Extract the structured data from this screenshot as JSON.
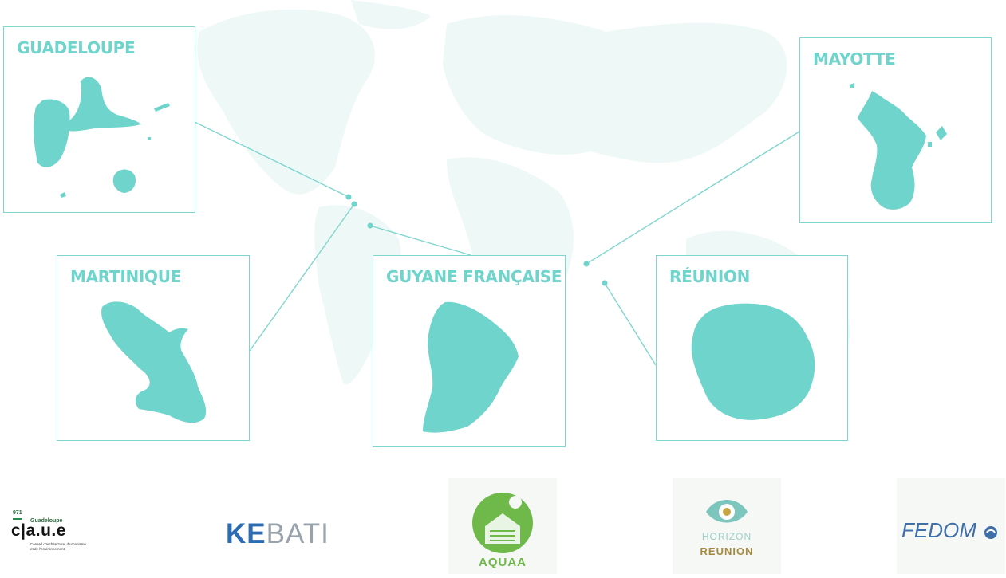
{
  "colors": {
    "accent": "#6fd4cc",
    "border": "#7fd6cf",
    "map_bg": "#eef9f7"
  },
  "regions": {
    "guadeloupe": {
      "name": "GUADELOUPE"
    },
    "mayotte": {
      "name": "MAYOTTE"
    },
    "martinique": {
      "name": "MARTINIQUE"
    },
    "guyane": {
      "name": "GUYANE FRANÇAISE"
    },
    "reunion": {
      "name": "RÉUNION"
    }
  },
  "logos": {
    "caue": {
      "number": "971",
      "region": "Guadeloupe",
      "word": "c|a.u.e",
      "subtitle_line1": "Conseil d'architecture, d'urbanisme",
      "subtitle_line2": "et de l'environnement"
    },
    "kebati": {
      "part1": "KE",
      "part2": "B",
      "part3": "ATI"
    },
    "aquaa": {
      "name": "AQUAA"
    },
    "horizon": {
      "line1": "HORIZON",
      "line2": "REUNION"
    },
    "fedom": {
      "name": "FEDOM"
    }
  }
}
